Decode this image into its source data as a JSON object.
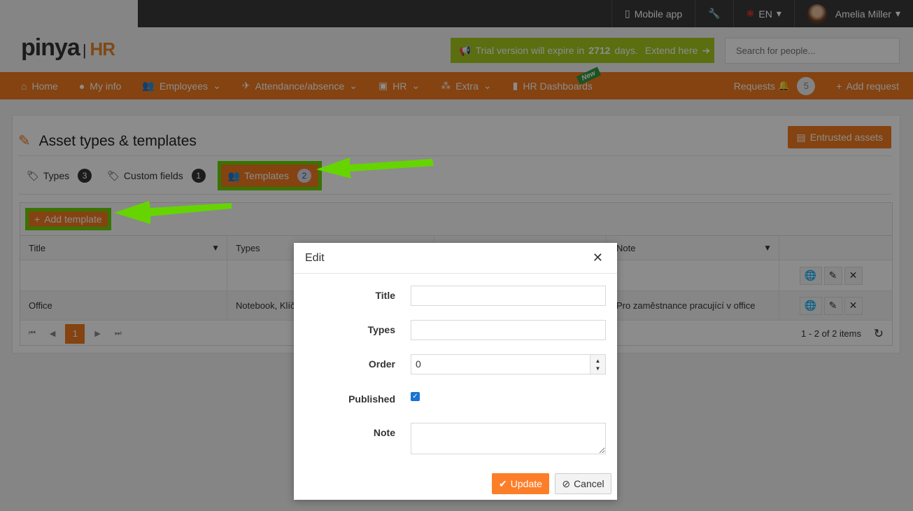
{
  "topbar": {
    "mobile_app": "Mobile app",
    "language": "EN",
    "user_name": "Amelia Miller"
  },
  "header": {
    "logo_text": "pinya",
    "logo_hr": "HR",
    "trial_prefix": "Trial version will expire in",
    "trial_days": "2712",
    "trial_suffix": "days.",
    "trial_link": "Extend here",
    "search_placeholder": "Search for people..."
  },
  "nav": {
    "items": [
      {
        "label": "Home"
      },
      {
        "label": "My info"
      },
      {
        "label": "Employees"
      },
      {
        "label": "Attendance/absence"
      },
      {
        "label": "HR"
      },
      {
        "label": "Extra"
      },
      {
        "label": "HR Dashboards"
      }
    ],
    "new_badge": "New",
    "requests": "Requests",
    "requests_count": "5",
    "add_request": "Add request"
  },
  "page": {
    "title": "Asset types & templates",
    "entrusted_button": "Entrusted assets",
    "tabs": [
      {
        "label": "Types",
        "count": "3"
      },
      {
        "label": "Custom fields",
        "count": "1"
      },
      {
        "label": "Templates",
        "count": "2"
      }
    ],
    "add_template": "Add template",
    "columns": [
      "Title",
      "Types",
      "Note"
    ],
    "rows": [
      {
        "title": "",
        "types": "",
        "note": ""
      },
      {
        "title": "Office",
        "types": "Notebook, Klíče",
        "note": "Pro zaměstnance pracující v office"
      }
    ],
    "page_current": "1",
    "pager_info": "1 - 2 of 2 items"
  },
  "modal": {
    "title": "Edit",
    "labels": {
      "title": "Title",
      "types": "Types",
      "order": "Order",
      "published": "Published",
      "note": "Note"
    },
    "values": {
      "title": "",
      "types": "",
      "order": "0",
      "published": true,
      "note": ""
    },
    "update": "Update",
    "cancel": "Cancel"
  },
  "colors": {
    "accent": "#f07a20",
    "highlight": "#66d400",
    "trial": "#a6c81e"
  }
}
